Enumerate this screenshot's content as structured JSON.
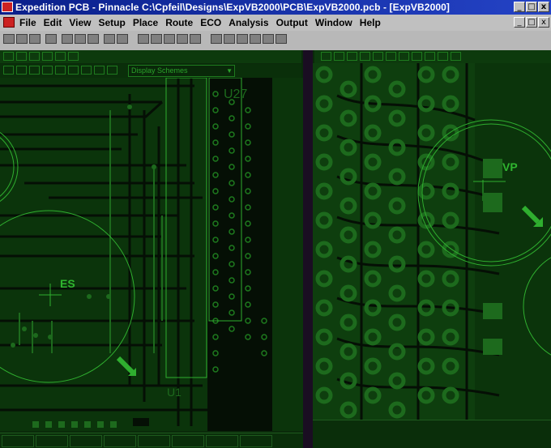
{
  "window": {
    "title": "Expedition PCB - Pinnacle  C:\\Cpfeil\\Designs\\ExpVB2000\\PCB\\ExpVB2000.pcb - [ExpVB2000]",
    "buttons": [
      "_",
      "□",
      "x"
    ]
  },
  "menubar": {
    "items": [
      "File",
      "Edit",
      "View",
      "Setup",
      "Place",
      "Route",
      "ECO",
      "Analysis",
      "Output",
      "Window",
      "Help"
    ],
    "mdi_buttons": [
      "_",
      "□",
      "x"
    ]
  },
  "toolbar": {
    "display_scheme": "Display Schemes"
  },
  "canvas_left": {
    "component_labels": [
      "U27",
      "U1"
    ],
    "ref_label": "ES"
  },
  "canvas_right": {
    "ref_label": "VP"
  },
  "colors": {
    "board": "#0b340b",
    "trace": "#050f05",
    "outline": "#2fae2f",
    "pad": "#1d6a1d",
    "titlebar": "#0a1f8a"
  }
}
